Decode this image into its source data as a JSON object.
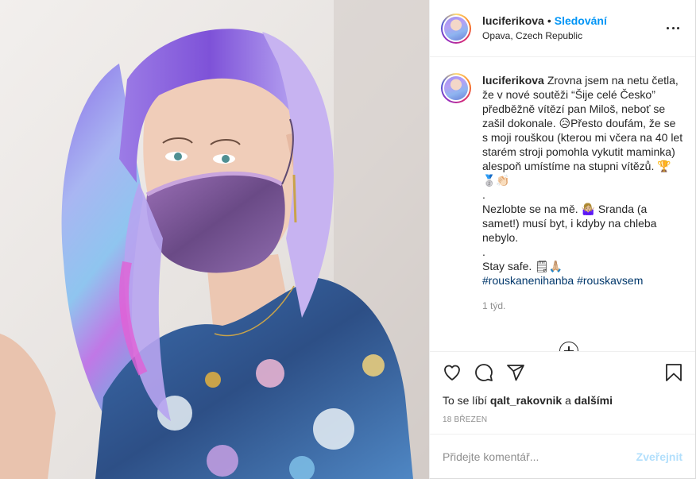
{
  "post": {
    "username": "luciferikova",
    "separator": "•",
    "follow_label": "Sledování",
    "location": "Opava, Czech Republic"
  },
  "caption": {
    "username": "luciferikova",
    "paragraph1": "Zrovna jsem na netu četla, že v nové soutěži “Šije celé Česko” předběžně vítězí pan Miloš, neboť se zašil dokonale. 😥Přesto doufám, že se s moji rouškou (kterou mi včera na 40 let starém stroji pomohla vykutit maminka) alespoň umístíme na stupni vítězů. 🏆🥈👏🏻",
    "dot1": ".",
    "paragraph2": "Nezlobte se na mě. 🤷🏼‍♀️ Sranda (a samet!) musí byt, i kdyby na chleba nebylo.",
    "dot2": ".",
    "paragraph3": "Stay safe. 🗒🙏🏼",
    "hashtags": "#rouskanenihanba #rouskavsem",
    "time": "1 týd."
  },
  "actions": {
    "icons": [
      "heart-icon",
      "comment-icon",
      "share-icon",
      "bookmark-icon"
    ],
    "likes_prefix": "To se líbí",
    "likes_user": "qalt_rakovnik",
    "likes_and": "a",
    "likes_others": "dalšími",
    "date": "18 březen"
  },
  "comment": {
    "placeholder": "Přidejte komentář...",
    "post_label": "Zveřejnit"
  },
  "colors": {
    "accent": "#0095f6",
    "hashtag": "#00376b",
    "muted": "#8e8e8e",
    "post_disabled": "#b2dffc"
  }
}
